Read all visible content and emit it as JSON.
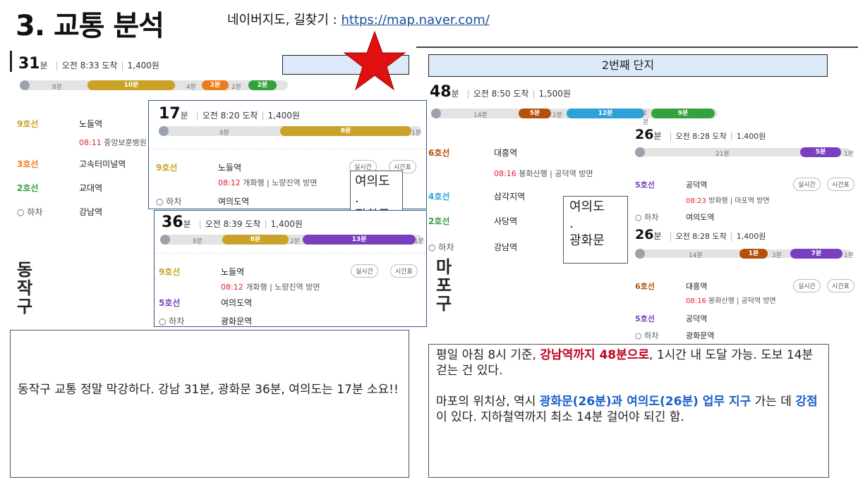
{
  "title": "3. 교통 분석",
  "source": {
    "prefix": "네이버지도, 길찾기 : ",
    "url": "https://map.naver.com/"
  },
  "banner2": "2번째 단지",
  "colors": {
    "line9": "#c9a227",
    "line3": "#ef7c1c",
    "line2": "#33a23d",
    "line4": "#2ea1d8",
    "line5": "#7a3fbf",
    "line6": "#b5500b",
    "star": "#e01010"
  },
  "route_a": {
    "mins": "31",
    "unit": "분",
    "arrive": "오전 8:33 도착",
    "fare": "1,400원",
    "bar": [
      "8분",
      "10분",
      "4분",
      "2분",
      "2분",
      "2분"
    ],
    "rows": [
      {
        "line": "9호선",
        "station": "노들역"
      },
      {
        "line": "3호선",
        "station": "고속터미널역"
      },
      {
        "line": "2호선",
        "station": "교대역"
      },
      {
        "line": "하차",
        "station": "강남역"
      }
    ],
    "sub": {
      "time": "08:11",
      "text": "중앙보훈병원"
    }
  },
  "route_b": {
    "mins": "17",
    "unit": "분",
    "arrive": "오전 8:20 도착",
    "fare": "1,400원",
    "bar": [
      "8분",
      "8분",
      "1분"
    ],
    "rows": [
      {
        "line": "9호선",
        "station": "노들역"
      },
      {
        "line": "하차",
        "station": "여의도역"
      }
    ],
    "sub": {
      "time": "08:12",
      "text": "개화행",
      "dir": "노량진역 방면"
    }
  },
  "route_c": {
    "mins": "36",
    "unit": "분",
    "arrive": "오전 8:39 도착",
    "fare": "1,400원",
    "bar": [
      "8분",
      "8분",
      "2분",
      "13분",
      "1분"
    ],
    "rows": [
      {
        "line": "9호선",
        "station": "노들역"
      },
      {
        "line": "5호선",
        "station": "여의도역"
      },
      {
        "line": "하차",
        "station": "광화문역"
      }
    ],
    "sub": {
      "time": "08:12",
      "text": "개화행",
      "dir": "노량진역 방면"
    }
  },
  "route_d": {
    "mins": "48",
    "unit": "분",
    "arrive": "오전 8:50 도착",
    "fare": "1,500원",
    "bar": [
      "14분",
      "5분",
      "2분",
      "12분",
      "2분",
      "9분"
    ],
    "rows": [
      {
        "line": "6호선",
        "station": "대흥역"
      },
      {
        "line": "4호선",
        "station": "삼각지역"
      },
      {
        "line": "2호선",
        "station": "사당역"
      },
      {
        "line": "하차",
        "station": "강남역"
      }
    ],
    "sub": {
      "time": "08:16",
      "text": "봉화산행",
      "dir": "공덕역 방면"
    }
  },
  "route_e": {
    "mins": "26",
    "unit": "분",
    "arrive": "오전 8:28 도착",
    "fare": "1,400원",
    "bar": [
      "21분",
      "5분",
      "1분"
    ],
    "rows": [
      {
        "line": "5호선",
        "station": "공덕역"
      },
      {
        "line": "하차",
        "station": "여의도역"
      }
    ],
    "sub": {
      "time": "08:23",
      "text": "방화행",
      "dir": "마포역 방면"
    }
  },
  "route_f": {
    "mins": "26",
    "unit": "분",
    "arrive": "오전 8:28 도착",
    "fare": "1,400원",
    "bar": [
      "14분",
      "1분",
      "3분",
      "7분",
      "1분"
    ],
    "rows": [
      {
        "line": "6호선",
        "station": "대흥역"
      },
      {
        "line": "5호선",
        "station": "공덕역"
      },
      {
        "line": "하차",
        "station": "광화문역"
      }
    ],
    "sub": {
      "time": "08:16",
      "text": "봉화산행",
      "dir": "공덕역 방면"
    }
  },
  "buttons": {
    "realtime": "실시간",
    "timetable": "시간표"
  },
  "callout": {
    "l1": "여의도",
    "l2": ".",
    "l3": "광화문"
  },
  "district_left": [
    "동",
    "작",
    "구"
  ],
  "district_right": [
    "마",
    "포",
    "구"
  ],
  "note_left": "동작구 교통 정말 막강하다. 강남 31분, 광화문 36분, 여의도는 17분 소요!!",
  "note_right": {
    "p1a": "평일 아침 8시 기준, ",
    "p1b": "강남역까지 48분으로",
    "p1c": ", 1시간 내 도달 가능. 도보 14분 걷는 건 있다.",
    "p2a": "마포의 위치상, 역시 ",
    "p2b": "광화문(26분)과 여의도(26분) 업무 지구",
    "p2c": " 가는 데 ",
    "p2d": "강점",
    "p2e": "이 있다. 지하철역까지 최소 14분 걸어야 되긴 함."
  }
}
